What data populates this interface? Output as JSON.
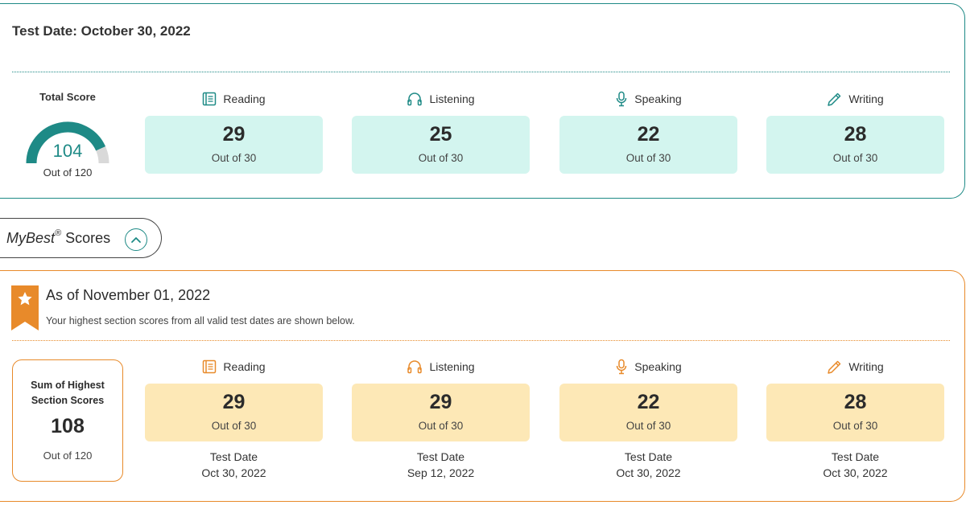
{
  "current_test": {
    "title": "Test Date: October 30, 2022",
    "total": {
      "label": "Total Score",
      "value": "104",
      "out_of": "Out of 120",
      "fraction": 0.8667
    },
    "sections": [
      {
        "name": "Reading",
        "icon": "book-icon",
        "score": "29",
        "out_of": "Out of 30"
      },
      {
        "name": "Listening",
        "icon": "headphones-icon",
        "score": "25",
        "out_of": "Out of 30"
      },
      {
        "name": "Speaking",
        "icon": "microphone-icon",
        "score": "22",
        "out_of": "Out of 30"
      },
      {
        "name": "Writing",
        "icon": "pencil-icon",
        "score": "28",
        "out_of": "Out of 30"
      }
    ]
  },
  "mybest": {
    "brand": "MyBest",
    "reg": "®",
    "label": "Scores",
    "toggle_icon": "chevron-up-icon"
  },
  "best_scores": {
    "title": "As of November 01, 2022",
    "subtitle": "Your highest section scores from all valid test dates are shown below.",
    "sum": {
      "label_line1": "Sum of Highest",
      "label_line2": "Section Scores",
      "value": "108",
      "out_of": "Out of 120"
    },
    "sections": [
      {
        "name": "Reading",
        "icon": "book-icon",
        "score": "29",
        "out_of": "Out of 30",
        "date_label": "Test Date",
        "date": "Oct 30, 2022"
      },
      {
        "name": "Listening",
        "icon": "headphones-icon",
        "score": "29",
        "out_of": "Out of 30",
        "date_label": "Test Date",
        "date": "Sep 12, 2022"
      },
      {
        "name": "Speaking",
        "icon": "microphone-icon",
        "score": "22",
        "out_of": "Out of 30",
        "date_label": "Test Date",
        "date": "Oct 30, 2022"
      },
      {
        "name": "Writing",
        "icon": "pencil-icon",
        "score": "28",
        "out_of": "Out of 30",
        "date_label": "Test Date",
        "date": "Oct 30, 2022"
      }
    ]
  },
  "colors": {
    "teal": "#1e8a86",
    "orange": "#e88a2a",
    "teal_box": "#d3f5ef",
    "orange_box": "#fde8b6"
  }
}
